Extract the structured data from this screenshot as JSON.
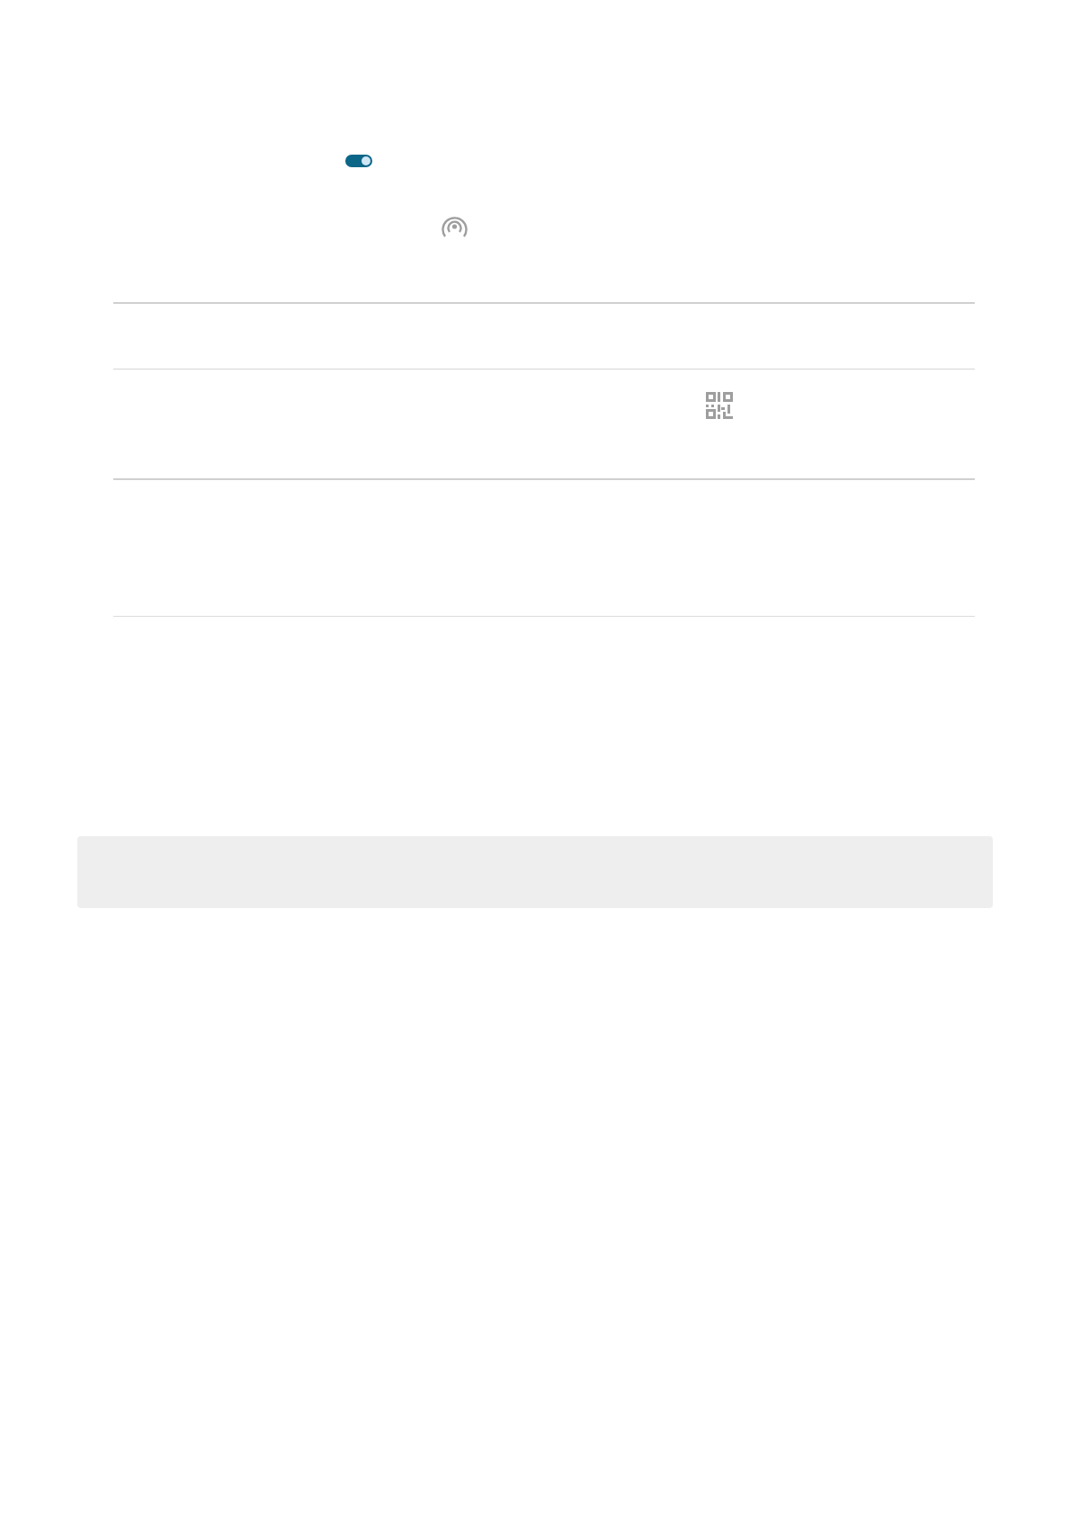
{
  "toggle": {
    "on": true
  }
}
